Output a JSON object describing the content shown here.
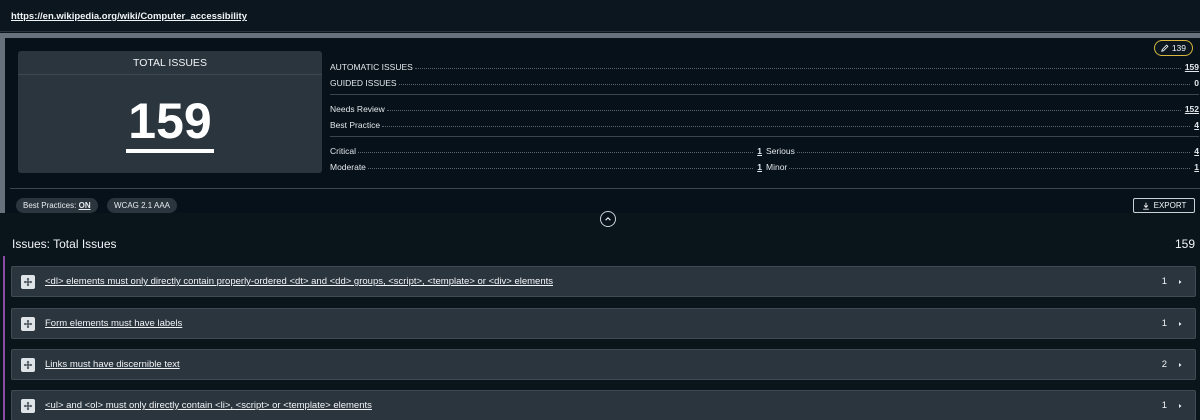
{
  "url": "https://en.wikipedia.org/wiki/Computer_accessibility",
  "summary": {
    "total_title": "TOTAL ISSUES",
    "total_value": "159",
    "edit_pill": "139",
    "automatic_label": "AUTOMATIC ISSUES",
    "automatic_value": "159",
    "guided_label": "GUIDED ISSUES",
    "guided_value": "0",
    "needs_review_label": "Needs Review",
    "needs_review_value": "152",
    "best_practice_label": "Best Practice",
    "best_practice_value": "4",
    "critical_label": "Critical",
    "critical_value": "1",
    "serious_label": "Serious",
    "serious_value": "4",
    "moderate_label": "Moderate",
    "moderate_value": "1",
    "minor_label": "Minor",
    "minor_value": "1",
    "best_practices_chip_label": "Best Practices:",
    "best_practices_chip_value": "ON",
    "wcag_chip": "WCAG 2.1 AAA",
    "export_label": "EXPORT"
  },
  "issues": {
    "heading": "Issues: Total Issues",
    "count": "159",
    "items": [
      {
        "title": "<dl> elements must only directly contain properly-ordered <dt> and <dd> groups, <script>, <template> or <div> elements",
        "count": "1"
      },
      {
        "title": "Form elements must have labels",
        "count": "1"
      },
      {
        "title": "Links must have discernible text",
        "count": "2"
      },
      {
        "title": "<ul> and <ol> must only directly contain <li>, <script> or <template> elements",
        "count": "1"
      }
    ]
  },
  "colors": {
    "accent_pill_border": "#d8b640",
    "side_line": "#8a4ba0",
    "panel": "#2b353e"
  }
}
